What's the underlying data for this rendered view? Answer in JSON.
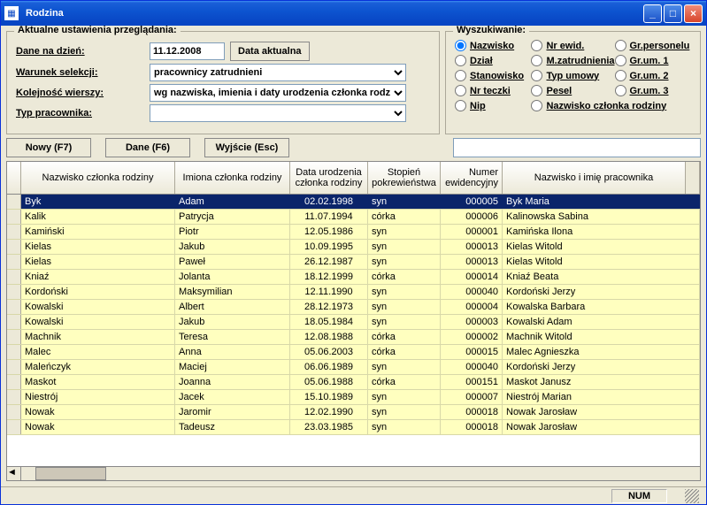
{
  "window": {
    "title": "Rodzina"
  },
  "settings": {
    "group_title": "Aktualne ustawienia przeglądania:",
    "date_label": "Dane na dzień:",
    "date_value": "11.12.2008",
    "date_button": "Data aktualna",
    "condition_label": "Warunek selekcji:",
    "condition_value": "pracownicy zatrudnieni",
    "order_label": "Kolejność wierszy:",
    "order_value": "wg nazwiska, imienia i daty urodzenia członka rodz",
    "type_label": "Typ pracownika:",
    "type_value": ""
  },
  "search": {
    "group_title": "Wyszukiwanie:",
    "options": [
      {
        "label": "Nazwisko",
        "checked": true
      },
      {
        "label": "Nr ewid.",
        "checked": false
      },
      {
        "label": "Gr.personelu",
        "checked": false
      },
      {
        "label": "Dział",
        "checked": false
      },
      {
        "label": "M.zatrudnienia",
        "checked": false
      },
      {
        "label": "Gr.um. 1",
        "checked": false
      },
      {
        "label": "Stanowisko",
        "checked": false
      },
      {
        "label": "Typ umowy",
        "checked": false
      },
      {
        "label": "Gr.um. 2",
        "checked": false
      },
      {
        "label": "Nr teczki",
        "checked": false
      },
      {
        "label": "Pesel",
        "checked": false
      },
      {
        "label": "Gr.um. 3",
        "checked": false
      },
      {
        "label": "Nip",
        "checked": false
      },
      {
        "label": "Nazwisko członka rodziny",
        "checked": false,
        "span": 2
      }
    ],
    "input_value": ""
  },
  "buttons": {
    "new": "Nowy (F7)",
    "data": "Dane (F6)",
    "exit": "Wyjście (Esc)"
  },
  "grid": {
    "headers": {
      "c1": "Nazwisko\nczłonka rodziny",
      "c2": "Imiona\nczłonka rodziny",
      "c3": "Data\nurodzenia\nczłonka rodziny",
      "c4": "Stopień\npokrewieństwa",
      "c5": "Numer\newidencyjny",
      "c6": "Nazwisko i imię pracownika"
    },
    "rows": [
      {
        "sel": true,
        "c1": "Byk",
        "c2": "Adam",
        "c3": "02.02.1998",
        "c4": "syn",
        "c5": "000005",
        "c6": "Byk Maria"
      },
      {
        "c1": "Kalik",
        "c2": "Patrycja",
        "c3": "11.07.1994",
        "c4": "córka",
        "c5": "000006",
        "c6": "Kalinowska Sabina"
      },
      {
        "c1": "Kamiński",
        "c2": "Piotr",
        "c3": "12.05.1986",
        "c4": "syn",
        "c5": "000001",
        "c6": "Kamińska Ilona"
      },
      {
        "c1": "Kielas",
        "c2": "Jakub",
        "c3": "10.09.1995",
        "c4": "syn",
        "c5": "000013",
        "c6": "Kielas Witold"
      },
      {
        "c1": "Kielas",
        "c2": "Paweł",
        "c3": "26.12.1987",
        "c4": "syn",
        "c5": "000013",
        "c6": "Kielas Witold"
      },
      {
        "c1": "Kniaź",
        "c2": "Jolanta",
        "c3": "18.12.1999",
        "c4": "córka",
        "c5": "000014",
        "c6": "Kniaź Beata"
      },
      {
        "c1": "Kordoński",
        "c2": "Maksymilian",
        "c3": "12.11.1990",
        "c4": "syn",
        "c5": "000040",
        "c6": "Kordoński Jerzy"
      },
      {
        "c1": "Kowalski",
        "c2": "Albert",
        "c3": "28.12.1973",
        "c4": "syn",
        "c5": "000004",
        "c6": "Kowalska Barbara"
      },
      {
        "c1": "Kowalski",
        "c2": "Jakub",
        "c3": "18.05.1984",
        "c4": "syn",
        "c5": "000003",
        "c6": "Kowalski Adam"
      },
      {
        "c1": "Machnik",
        "c2": "Teresa",
        "c3": "12.08.1988",
        "c4": "córka",
        "c5": "000002",
        "c6": "Machnik Witold"
      },
      {
        "c1": "Malec",
        "c2": "Anna",
        "c3": "05.06.2003",
        "c4": "córka",
        "c5": "000015",
        "c6": "Malec Agnieszka"
      },
      {
        "c1": "Maleńczyk",
        "c2": "Maciej",
        "c3": "06.06.1989",
        "c4": "syn",
        "c5": "000040",
        "c6": "Kordoński Jerzy"
      },
      {
        "c1": "Maskot",
        "c2": "Joanna",
        "c3": "05.06.1988",
        "c4": "córka",
        "c5": "000151",
        "c6": "Maskot Janusz"
      },
      {
        "c1": "Niestrój",
        "c2": "Jacek",
        "c3": "15.10.1989",
        "c4": "syn",
        "c5": "000007",
        "c6": "Niestrój Marian"
      },
      {
        "c1": "Nowak",
        "c2": "Jaromir",
        "c3": "12.02.1990",
        "c4": "syn",
        "c5": "000018",
        "c6": "Nowak Jarosław"
      },
      {
        "c1": "Nowak",
        "c2": "Tadeusz",
        "c3": "23.03.1985",
        "c4": "syn",
        "c5": "000018",
        "c6": "Nowak Jarosław"
      }
    ]
  },
  "statusbar": {
    "num": "NUM"
  }
}
